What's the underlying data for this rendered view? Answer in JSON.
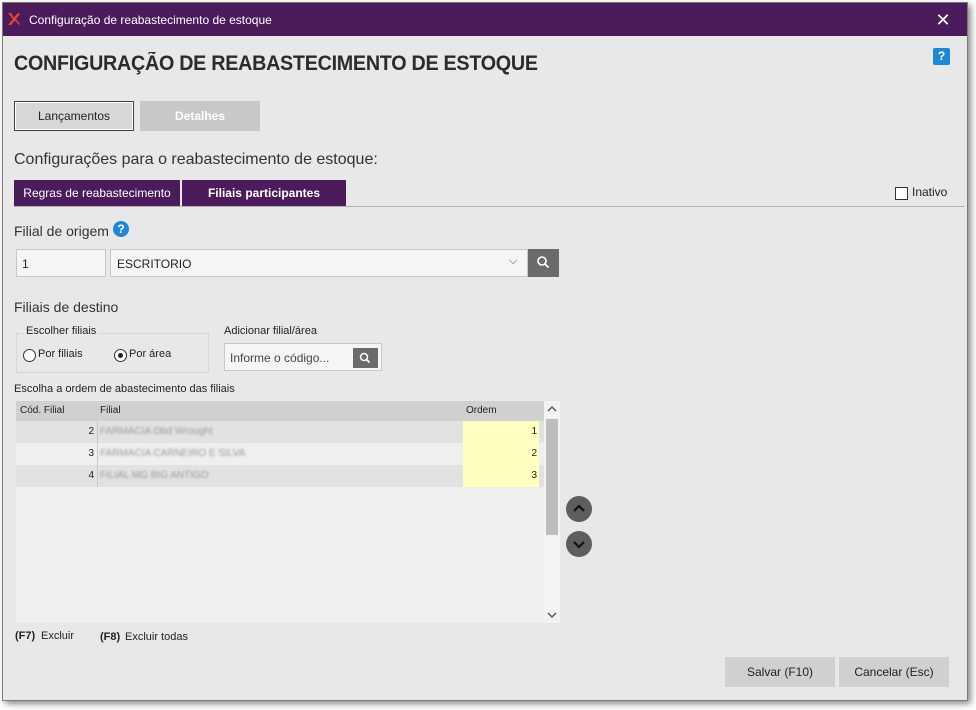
{
  "window": {
    "title": "Configuração de reabastecimento de estoque",
    "close_glyph": "✕"
  },
  "page": {
    "title": "CONFIGURAÇÃO DE REABASTECIMENTO DE ESTOQUE",
    "help_glyph": "?"
  },
  "top_tabs": {
    "lancamentos": "Lançamentos",
    "detalhes": "Detalhes"
  },
  "section": {
    "title": "Configurações para o reabastecimento de estoque:"
  },
  "sub_tabs": {
    "regras": "Regras de reabastecimento",
    "filiais": "Filiais participantes"
  },
  "inativo": {
    "label": "Inativo",
    "checked": false
  },
  "origem": {
    "label": "Filial de origem",
    "help_glyph": "?",
    "code": "1",
    "name": "ESCRITORIO",
    "dropdown_glyph": "⌵"
  },
  "destino": {
    "label": "Filiais de destino",
    "choose_legend": "Escolher filiais",
    "radio_por_filiais": "Por filiais",
    "radio_por_area": "Por área",
    "selected": "Por área",
    "add_label": "Adicionar filial/área",
    "add_placeholder": "Informe o código..."
  },
  "grid": {
    "caption": "Escolha a ordem de abastecimento das filiais",
    "headers": {
      "cod": "Cód. Filial",
      "filial": "Filial",
      "ordem": "Ordem"
    },
    "rows": [
      {
        "cod": "2",
        "filial": "FARMACIA Obd Wrought",
        "ordem": "1"
      },
      {
        "cod": "3",
        "filial": "FARMACIA CARNEIRO E SILVA",
        "ordem": "2"
      },
      {
        "cod": "4",
        "filial": "FILIAL MG BIG ANTIGO",
        "ordem": "3"
      }
    ]
  },
  "footer_keys": {
    "f7_key": "(F7)",
    "f7_label": "Excluir",
    "f8_key": "(F8)",
    "f8_label": "Excluir todas"
  },
  "buttons": {
    "save": "Salvar (F10)",
    "cancel": "Cancelar (Esc)"
  },
  "colors": {
    "accent": "#4b1b5c",
    "highlight": "#ffffc0",
    "help": "#1e88d6"
  }
}
